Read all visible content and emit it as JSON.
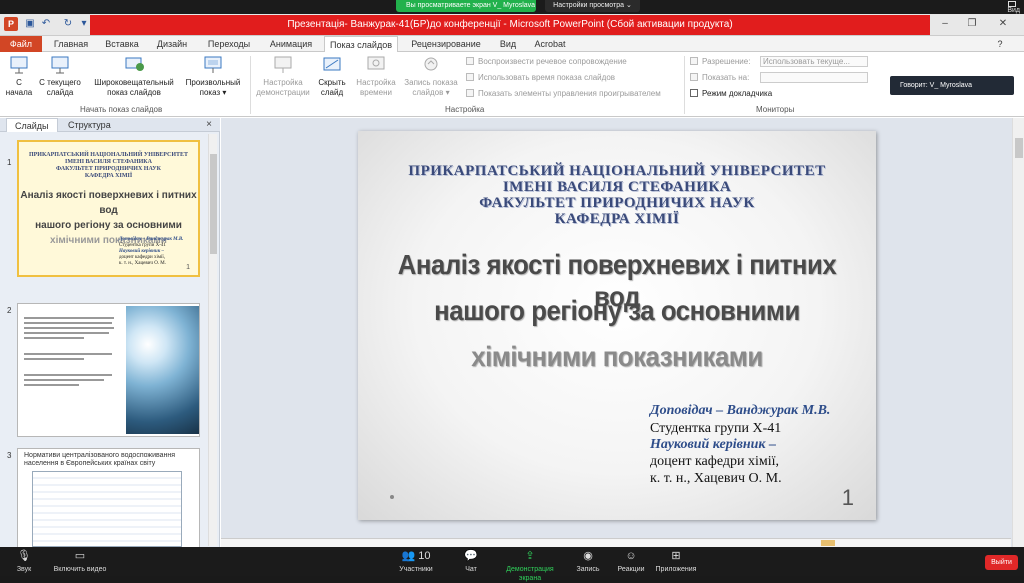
{
  "zoom_top": {
    "sharing_label": "Вы просматриваете экран V_ Myroslava",
    "view_options_label": "Настройки просмотра ⌄",
    "view_label": "Вид"
  },
  "powerpoint": {
    "logo_letter": "P",
    "window_title": "Презентація- Ванжурак-41(БР)до конференції  -  Microsoft PowerPoint (Сбой активации продукта)",
    "tabs": {
      "file": "Файл",
      "home": "Главная",
      "insert": "Вставка",
      "design": "Дизайн",
      "transitions": "Переходы",
      "animation": "Анимация",
      "slideshow": "Показ слайдов",
      "review": "Рецензирование",
      "view": "Вид",
      "acrobat": "Acrobat"
    },
    "ribbon": {
      "from_start_1": "С",
      "from_start_2": "начала",
      "from_current_1": "С текущего",
      "from_current_2": "слайда",
      "broadcast_1": "Широковещательный",
      "broadcast_2": "показ слайдов",
      "custom_1": "Произвольный",
      "custom_2": "показ ▾",
      "group_start": "Начать показ слайдов",
      "setup_1": "Настройка",
      "setup_2": "демонстрации",
      "hide_1": "Скрыть",
      "hide_2": "слайд",
      "rehearse_1": "Настройка",
      "rehearse_2": "времени",
      "record_1": "Запись показа",
      "record_2": "слайдов ▾",
      "play_narration": "Воспроизвести речевое сопровождение",
      "use_timings": "Использовать время показа слайдов",
      "show_controls": "Показать элементы управления проигрывателем",
      "group_setup": "Настройка",
      "resolution_label": "Разрешение:",
      "resolution_value": "Использовать текуще...",
      "show_on_label": "Показать на:",
      "presenter_view": "Режим докладчика",
      "group_monitors": "Мониторы"
    },
    "slides_pane": {
      "tab_slides": "Слайды",
      "tab_structure": "Структура",
      "close": "×",
      "slide_numbers": [
        "1",
        "2",
        "3"
      ],
      "thumb3_heading": "Нормативи централізованого водоспоживання населення в Європейських країнах світу"
    },
    "slide": {
      "university": [
        "ПРИКАРПАТСЬКИЙ  НАЦІОНАЛЬНИЙ  УНІВЕРСИТЕТ",
        "ІМЕНІ ВАСИЛЯ СТЕФАНИКА",
        "ФАКУЛЬТЕТ  ПРИРОДНИЧИХ  НАУК",
        "КАФЕДРА  ХІМІЇ"
      ],
      "title_lines": [
        "Аналіз якості поверхневих і питних вод",
        "нашого регіону за основними",
        "хімічними показниками"
      ],
      "speaker_role": "Доповідач – Ванджурак М.В.",
      "speaker_group": "Студентка групи Х-41",
      "advisor_role": "Науковий керівник –",
      "advisor_line1": "доцент  кафедри хімії,",
      "advisor_line2": "к. т. н., Хацевич О. М.",
      "number": "1"
    }
  },
  "speaking_banner": "Говорит: V_ Myroslava",
  "zoom_bottom": {
    "audio": "Звук",
    "video": "Включить видео",
    "participants": "Участники",
    "participants_count": "10",
    "chat": "Чат",
    "share": "Демонстрация экрана",
    "record": "Запись",
    "reactions": "Реакции",
    "apps": "Приложения",
    "end": "Выйти"
  }
}
